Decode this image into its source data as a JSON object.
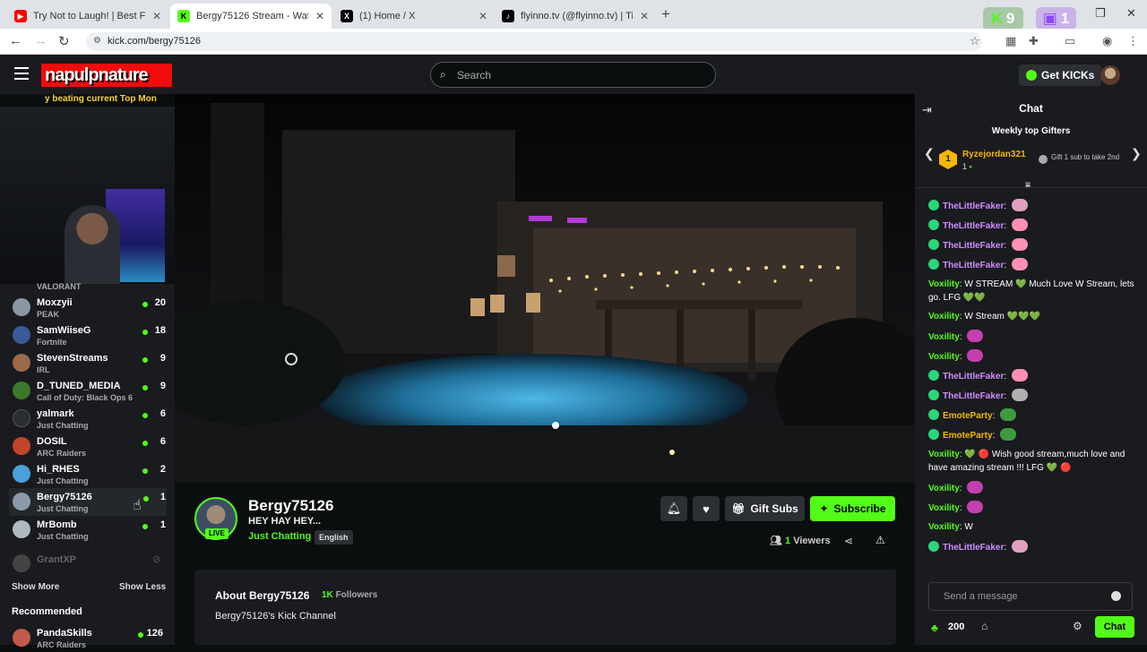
{
  "browser": {
    "tabs": [
      {
        "title": "Try Not to Laugh! | Best Fails of",
        "fav_color": "#ff0000",
        "fav_glyph": "▶",
        "icon": "youtube-icon"
      },
      {
        "title": "Bergy75126 Stream - Watch Liv",
        "fav_color": "#53fc18",
        "fav_glyph": "K",
        "icon": "kick-icon",
        "active": true
      },
      {
        "title": "(1) Home / X",
        "fav_color": "#000000",
        "fav_glyph": "X",
        "icon": "x-icon"
      },
      {
        "title": "flyinno.tv (@flyinno.tv) | TikTok",
        "fav_color": "#000000",
        "fav_glyph": "♪",
        "icon": "tiktok-icon"
      }
    ],
    "url": "kick.com/bergy75126",
    "kick_ext_count": "9",
    "twitch_ext_count": "1"
  },
  "header": {
    "search_placeholder": "Search",
    "get_kicks_label": "Get KICKs"
  },
  "overlay": {
    "logo_text": "napulpnature",
    "ticker_text": "y beating current Top Mon"
  },
  "sidebar": {
    "partial_category": "VALORANT",
    "channels": [
      {
        "name": "Moxzyii",
        "category": "PEAK",
        "viewers": "20",
        "avatar_color": "#8a96a3"
      },
      {
        "name": "SamWiiseG",
        "category": "Fortnite",
        "viewers": "18",
        "avatar_color": "#3a5a9a"
      },
      {
        "name": "StevenStreams",
        "category": "IRL",
        "viewers": "9",
        "avatar_color": "#9a6a4a"
      },
      {
        "name": "D_TUNED_MEDIA",
        "category": "Call of Duty: Black Ops 6",
        "viewers": "9",
        "avatar_color": "#3a7a2a"
      },
      {
        "name": "yalmark",
        "category": "Just Chatting",
        "viewers": "6",
        "avatar_color": "#2a2d33"
      },
      {
        "name": "DOSIL",
        "category": "ARC Raiders",
        "viewers": "6",
        "avatar_color": "#c2452b"
      },
      {
        "name": "Hi_RHES",
        "category": "Just Chatting",
        "viewers": "2",
        "avatar_color": "#4aa0d8"
      },
      {
        "name": "Bergy75126",
        "category": "Just Chatting",
        "viewers": "1",
        "avatar_color": "#8a9aab"
      },
      {
        "name": "MrBomb",
        "category": "Just Chatting",
        "viewers": "1",
        "avatar_color": "#b0b8c0"
      }
    ],
    "offline_channel": "GrantXP",
    "show_more": "Show More",
    "show_less": "Show Less",
    "recommended_title": "Recommended",
    "recommended": [
      {
        "name": "PandaSkills",
        "category": "ARC Raiders",
        "viewers": "126",
        "avatar_color": "#c25a4a"
      }
    ]
  },
  "stream": {
    "name": "Bergy75126",
    "title": "HEY HAY HEY...",
    "category": "Just Chatting",
    "language": "English",
    "live_label": "LIVE",
    "gift_label": "Gift Subs",
    "subscribe_label": "Subscribe",
    "viewers_count": "1",
    "viewers_label": "Viewers",
    "about_title": "About Bergy75126",
    "followers_count": "1K",
    "followers_label": "Followers",
    "about_desc": "Bergy75126's Kick Channel"
  },
  "chat": {
    "title": "Chat",
    "gifters_title": "Weekly top Gifters",
    "top_gifter": {
      "rank": "1",
      "name": "Ryzejordan321",
      "count": "1"
    },
    "gift_hint": "Gift 1 sub to take 2nd",
    "input_placeholder": "Send a message",
    "kicks_amount": "200",
    "chat_button": "Chat",
    "colors": {
      "green_user": "#53fc18",
      "purple_user": "#d28cff",
      "yellow_user": "#f5b800"
    },
    "messages": [
      {
        "user": "TheLittleFaker",
        "color": "#d28cff",
        "badge": true,
        "text": "",
        "emote": "#e0a0c0"
      },
      {
        "user": "TheLittleFaker",
        "color": "#d28cff",
        "badge": true,
        "text": "",
        "emote": "#ff8fb3"
      },
      {
        "user": "TheLittleFaker",
        "color": "#d28cff",
        "badge": true,
        "text": "",
        "emote": "#ff8fb3"
      },
      {
        "user": "TheLittleFaker",
        "color": "#d28cff",
        "badge": true,
        "text": "",
        "emote": "#ff8fb3"
      },
      {
        "user": "Voxility",
        "color": "#53fc18",
        "badge": false,
        "text": "W STREAM 💚 Much Love W Stream, lets go. LFG 💚💚",
        "emote": ""
      },
      {
        "user": "Voxility",
        "color": "#53fc18",
        "badge": false,
        "text": "W Stream 💚💚💚",
        "emote": ""
      },
      {
        "user": "Voxility",
        "color": "#53fc18",
        "badge": false,
        "text": "",
        "emote": "#c43fb0"
      },
      {
        "user": "Voxility",
        "color": "#53fc18",
        "badge": false,
        "text": "",
        "emote": "#c43fb0"
      },
      {
        "user": "TheLittleFaker",
        "color": "#d28cff",
        "badge": true,
        "text": "",
        "emote": "#ff8fb3"
      },
      {
        "user": "TheLittleFaker",
        "color": "#d28cff",
        "badge": true,
        "text": "",
        "emote": "#b0b0b0"
      },
      {
        "user": "EmoteParty",
        "color": "#f5b800",
        "badge": true,
        "text": "",
        "emote": "#3f9a3f"
      },
      {
        "user": "EmoteParty",
        "color": "#f5b800",
        "badge": true,
        "text": "",
        "emote": "#3f9a3f"
      },
      {
        "user": "Voxility",
        "color": "#53fc18",
        "badge": false,
        "text": "💚 🔴 Wish good stream,much love and have amazing stream !!! LFG 💚 🔴",
        "emote": ""
      },
      {
        "user": "Voxility",
        "color": "#53fc18",
        "badge": false,
        "text": "",
        "emote": "#c43fb0"
      },
      {
        "user": "Voxility",
        "color": "#53fc18",
        "badge": false,
        "text": "",
        "emote": "#c43fb0"
      },
      {
        "user": "Voxility",
        "color": "#53fc18",
        "badge": false,
        "text": "W",
        "emote": ""
      },
      {
        "user": "TheLittleFaker",
        "color": "#d28cff",
        "badge": true,
        "text": "",
        "emote": "#e0a0c0"
      }
    ]
  }
}
